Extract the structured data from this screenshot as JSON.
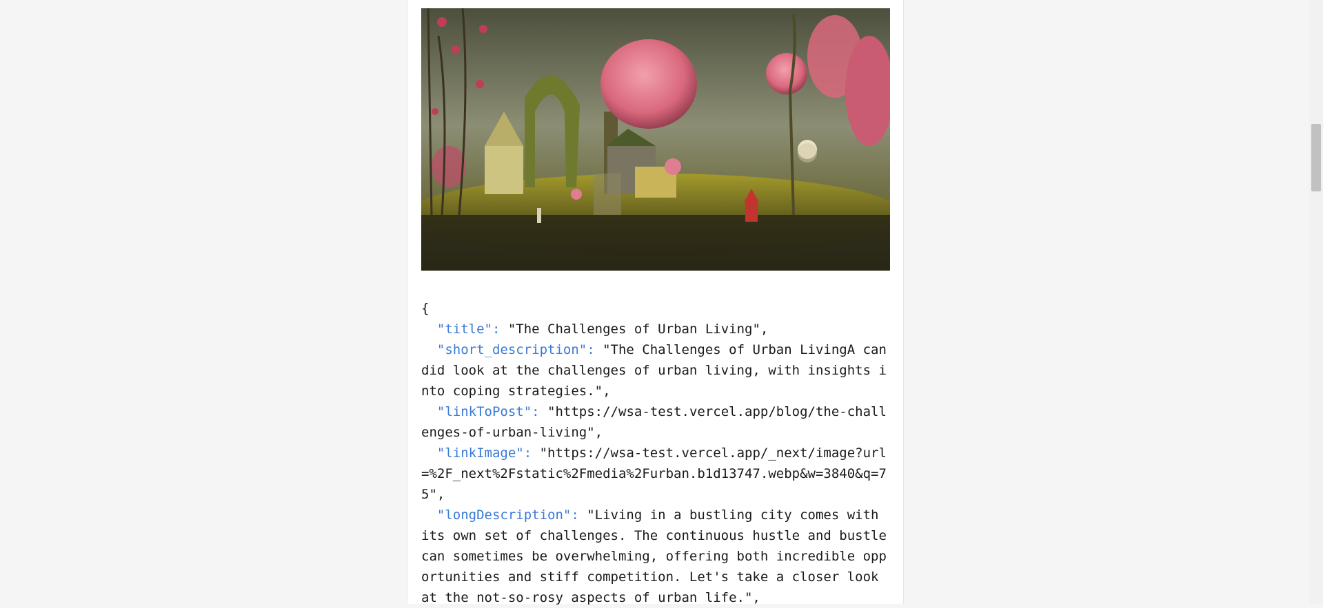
{
  "post": {
    "image_alt": "Surreal pink mushroom fantasy landscape",
    "json_open": "{",
    "fields": [
      {
        "key": "\"title\":",
        "value": " \"The Challenges of Urban Living\","
      },
      {
        "key": "\"short_description\":",
        "value": " \"The Challenges of Urban LivingA candid look at the challenges of urban living, with insights into coping strategies.\","
      },
      {
        "key": "\"linkToPost\":",
        "value": " \"https://wsa-test.vercel.app/blog/the-challenges-of-urban-living\","
      },
      {
        "key": "\"linkImage\":",
        "value": " \"https://wsa-test.vercel.app/_next/image?url=%2F_next%2Fstatic%2Fmedia%2Furban.b1d13747.webp&w=3840&q=75\","
      },
      {
        "key": "\"longDescription\":",
        "value": " \"Living in a bustling city comes with its own set of challenges. The continuous hustle and bustle can sometimes be overwhelming, offering both incredible opportunities and stiff competition. Let's take a closer look at the not-so-rosy aspects of urban life.\","
      }
    ]
  },
  "colors": {
    "key_color": "#3a7ad6",
    "page_bg": "#f5f5f5"
  }
}
